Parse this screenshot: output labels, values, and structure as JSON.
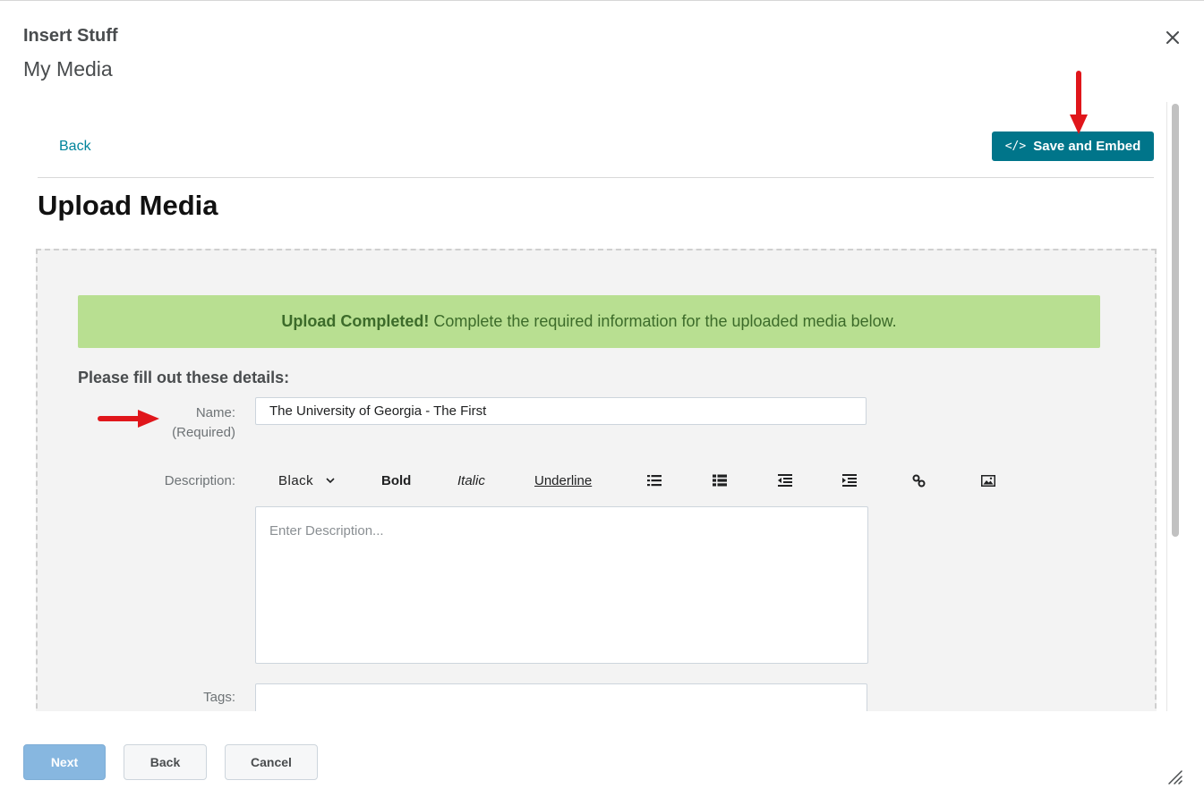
{
  "dialog": {
    "title": "Insert Stuff",
    "subtitle": "My Media",
    "close_icon": "close-icon"
  },
  "content": {
    "back_link": "Back",
    "save_embed_icon": "</>",
    "save_embed_label": "Save and Embed",
    "page_title": "Upload Media",
    "banner": {
      "strong": "Upload Completed!",
      "text": "Complete the required information for the uploaded media below.",
      "bg_color": "#b8df91"
    },
    "details_heading": "Please fill out these details:",
    "name_label": "Name:",
    "name_required": "(Required)",
    "name_value": "The University of Georgia - The First",
    "description_label": "Description:",
    "toolbar": {
      "color": "Black",
      "bold": "Bold",
      "italic": "Italic",
      "underline": "Underline",
      "icons": [
        "bulleted-list-icon",
        "numbered-list-icon",
        "outdent-icon",
        "indent-icon",
        "link-icon",
        "image-icon"
      ]
    },
    "description_placeholder": "Enter Description...",
    "tags_label": "Tags:"
  },
  "footer": {
    "next": "Next",
    "back": "Back",
    "cancel": "Cancel"
  },
  "colors": {
    "accent": "#00758a",
    "link": "#00849c",
    "annotation_arrow": "#e0161b"
  }
}
